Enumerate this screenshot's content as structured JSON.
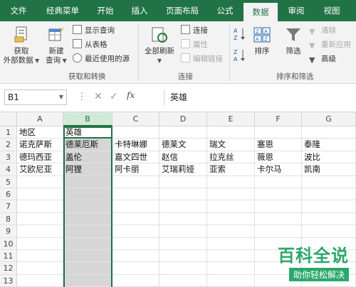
{
  "tabs": [
    "文件",
    "经典菜单",
    "开始",
    "插入",
    "页面布局",
    "公式",
    "数据",
    "审阅",
    "视图"
  ],
  "active_tab": "数据",
  "ribbon": {
    "get_external": {
      "line1": "获取",
      "line2": "外部数据"
    },
    "new_query": {
      "line1": "新建",
      "line2": "查询"
    },
    "show_queries": "显示查询",
    "from_table": "从表格",
    "recent_sources": "最近使用的源",
    "group_get_transform": "获取和转换",
    "refresh_all": "全部刷新",
    "connections": "连接",
    "properties": "属性",
    "edit_links": "编辑链接",
    "group_connections": "连接",
    "sort": "排序",
    "filter": "筛选",
    "clear": "清除",
    "reapply": "重新应用",
    "advanced": "高级",
    "group_sort_filter": "排序和筛选"
  },
  "formula_bar": {
    "name_box": "B1",
    "fx": "fx",
    "value": "英雄"
  },
  "columns": [
    "A",
    "B",
    "C",
    "D",
    "E",
    "F",
    "G"
  ],
  "rows": [
    "1",
    "2",
    "3",
    "4",
    "5",
    "6",
    "7",
    "8",
    "9",
    "10",
    "11",
    "12",
    "13"
  ],
  "cells": [
    [
      "地区",
      "英雄",
      "",
      "",
      "",
      "",
      ""
    ],
    [
      "诺克萨斯",
      "德莱厄斯",
      "卡特琳娜",
      "德莱文",
      "瑞文",
      "塞恩",
      "泰隆"
    ],
    [
      "德玛西亚",
      "盖伦",
      "嘉文四世",
      "赵信",
      "拉克丝",
      "薇恩",
      "波比"
    ],
    [
      "艾欧尼亚",
      "阿狸",
      "阿卡丽",
      "艾瑞莉娅",
      "亚索",
      "卡尔马",
      "凯南"
    ]
  ],
  "watermark": {
    "main": "百科全说",
    "sub": "助你轻松解决"
  },
  "colors": {
    "accent": "#217346",
    "selection": "#d6d6d6"
  }
}
